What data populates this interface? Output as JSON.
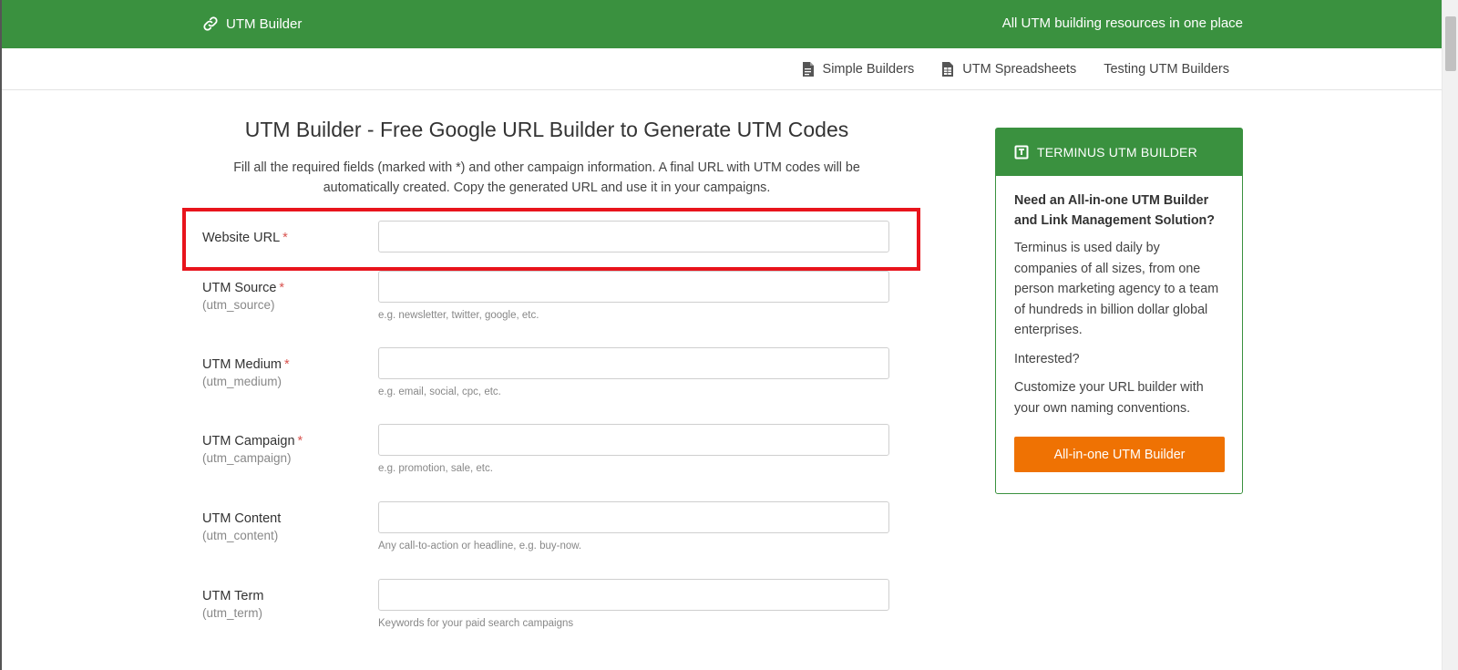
{
  "header": {
    "brand": "UTM Builder",
    "tagline": "All UTM building resources in one place",
    "brand_color": "#3a913f"
  },
  "subnav": [
    {
      "label": "Simple Builders",
      "icon": "document-icon"
    },
    {
      "label": "UTM Spreadsheets",
      "icon": "spreadsheet-icon"
    },
    {
      "label": "Testing UTM Builders",
      "icon": ""
    }
  ],
  "main": {
    "title": "UTM Builder - Free Google URL Builder to Generate UTM Codes",
    "intro": "Fill all the required fields (marked with *) and other campaign information. A final URL with UTM codes will be automatically created. Copy the generated URL and use it in your campaigns."
  },
  "form": {
    "rows": [
      {
        "label": "Website URL",
        "required": "*",
        "sub": "",
        "value": "",
        "hint": ""
      },
      {
        "label": "UTM Source",
        "required": "*",
        "sub": "(utm_source)",
        "value": "",
        "hint": "e.g. newsletter, twitter, google, etc."
      },
      {
        "label": "UTM Medium",
        "required": "*",
        "sub": "(utm_medium)",
        "value": "",
        "hint": "e.g. email, social, cpc, etc."
      },
      {
        "label": "UTM Campaign",
        "required": "*",
        "sub": "(utm_campaign)",
        "value": "",
        "hint": "e.g. promotion, sale, etc."
      },
      {
        "label": "UTM Content",
        "required": "",
        "sub": "(utm_content)",
        "value": "",
        "hint": "Any call-to-action or headline, e.g. buy-now."
      },
      {
        "label": "UTM Term",
        "required": "",
        "sub": "(utm_term)",
        "value": "",
        "hint": "Keywords for your paid search campaigns"
      }
    ],
    "highlight_color": "#e8141c"
  },
  "sidebar": {
    "header": "TERMINUS UTM BUILDER",
    "question": "Need an All-in-one UTM Builder and Link Management Solution?",
    "p1": "Terminus is used daily by companies of all sizes, from one person marketing agency to a team of hundreds in billion dollar global enterprises.",
    "p2": "Interested?",
    "p3": "Customize your URL builder with your own naming conventions.",
    "cta": "All-in-one UTM Builder",
    "cta_color": "#ef7203"
  }
}
